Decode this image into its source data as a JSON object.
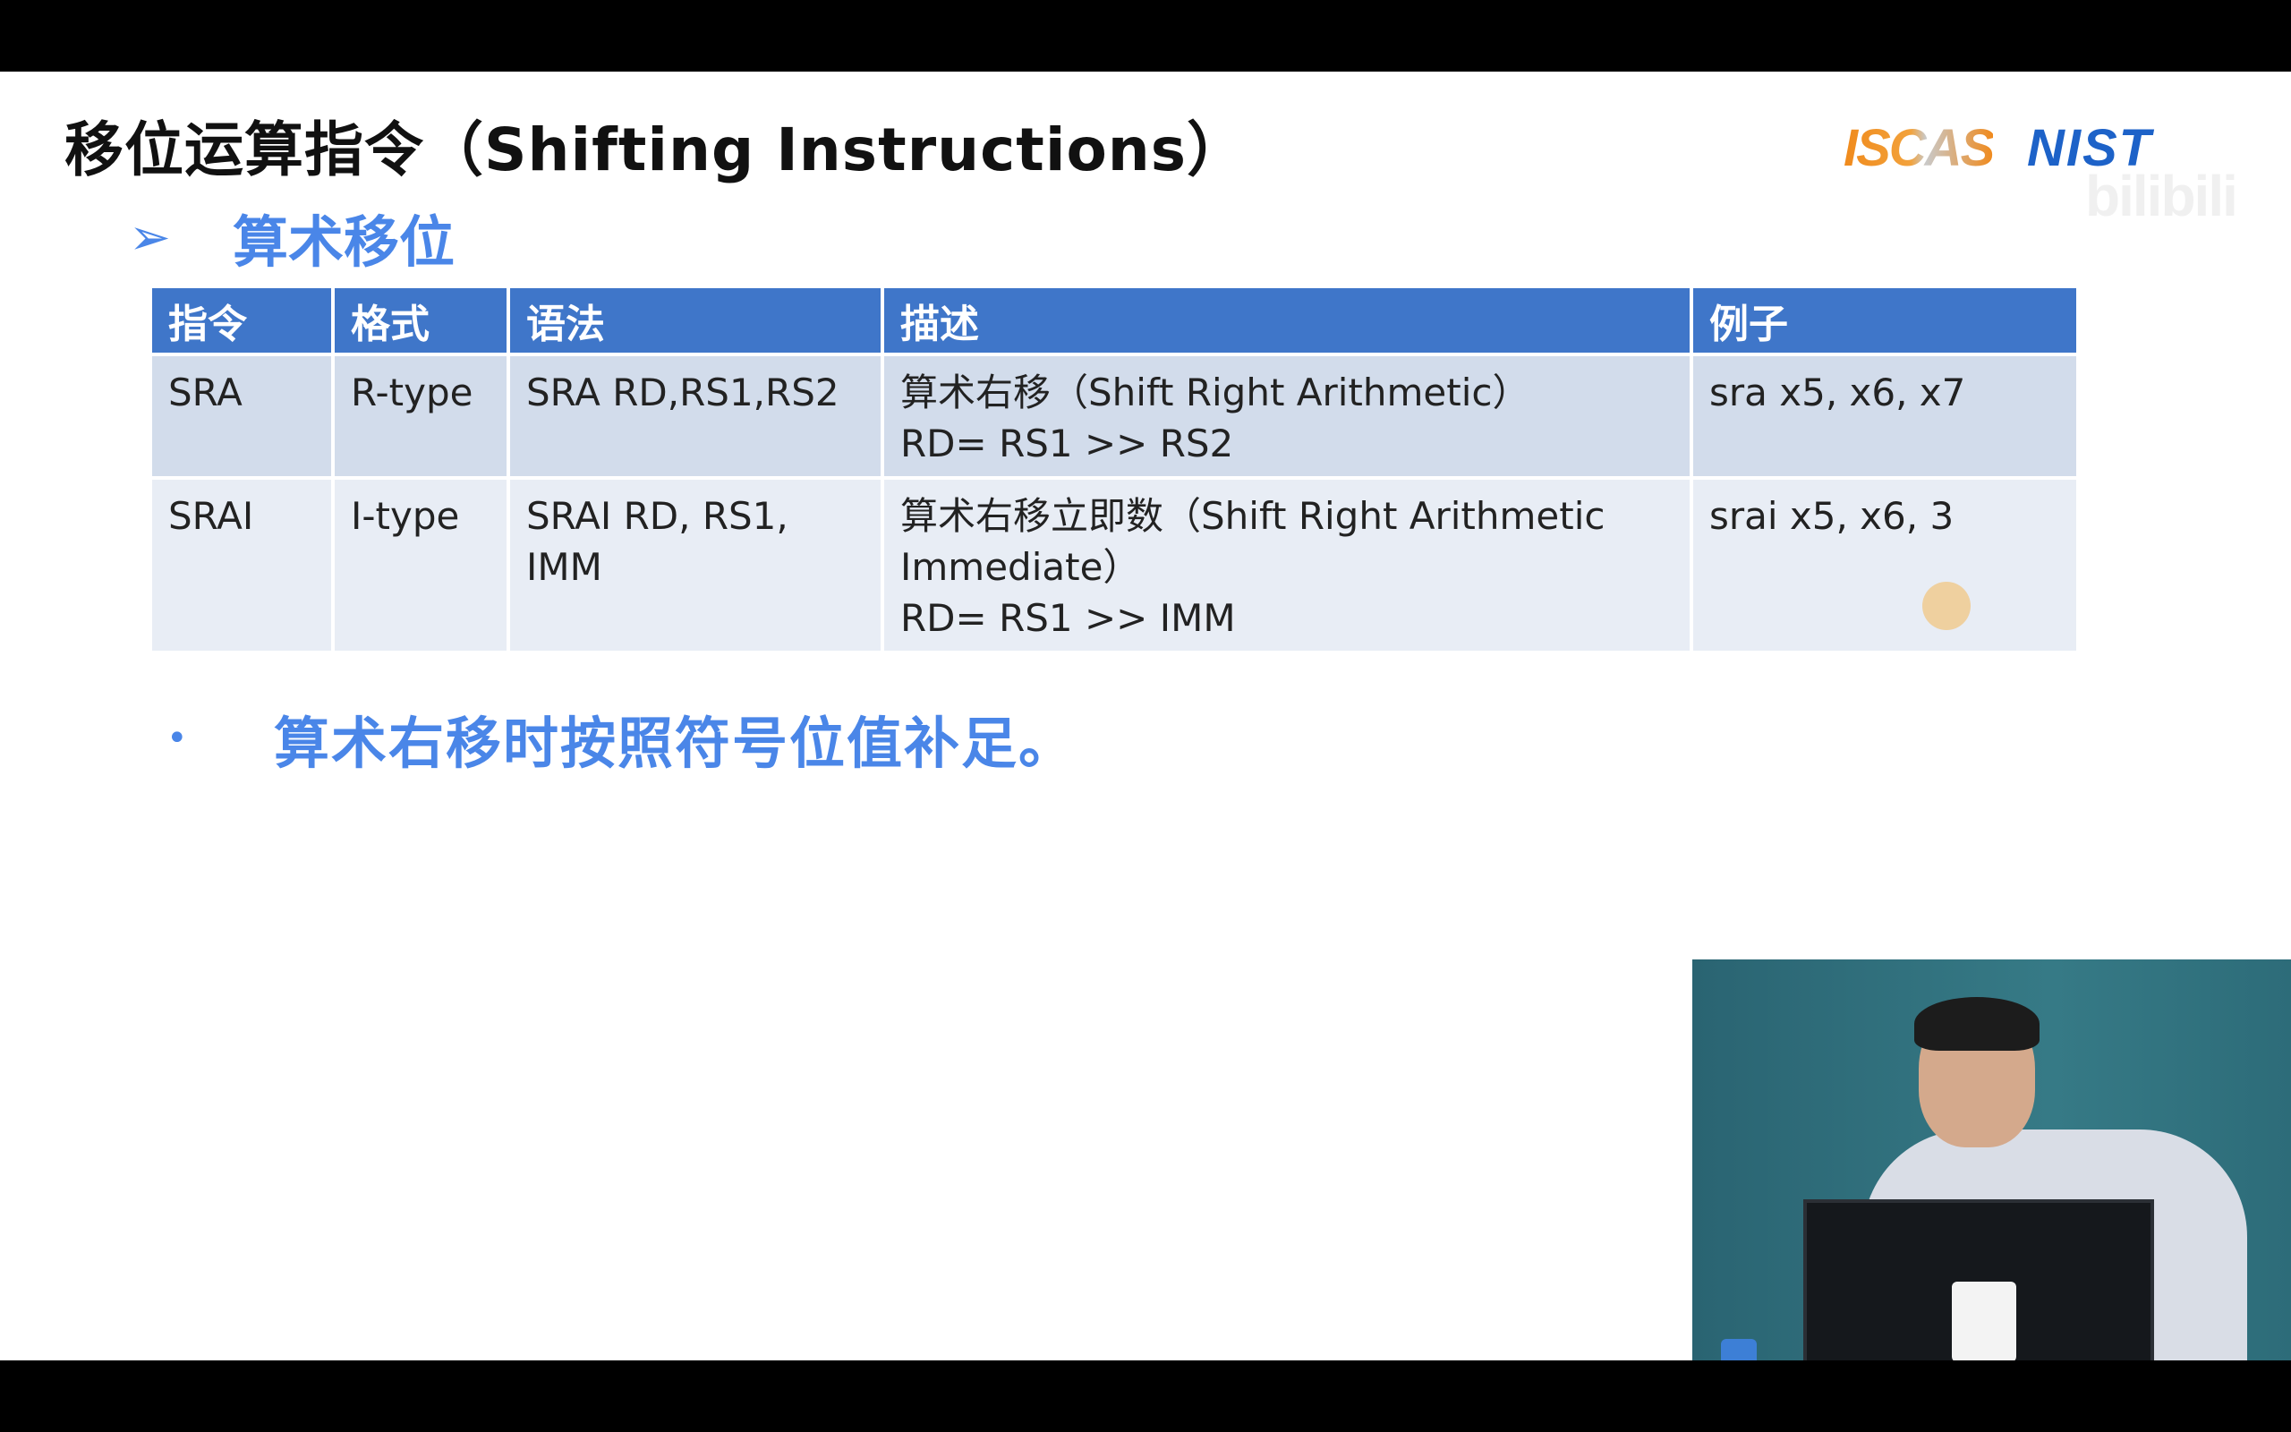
{
  "slide": {
    "title": "移位运算指令（Shifting Instructions）",
    "logos": {
      "iscas": "ISCAS",
      "nist": "NIST"
    },
    "watermark": "bilibili",
    "section": {
      "marker": "➢",
      "title": "算术移位"
    },
    "table": {
      "headers": [
        "指令",
        "格式",
        "语法",
        "描述",
        "例子"
      ],
      "rows": [
        {
          "instr": "SRA",
          "format": "R-type",
          "syntax_1": "SRA RD,RS1,RS2",
          "syntax_2": "",
          "desc_1": "算术右移（Shift Right Arithmetic）",
          "desc_2": "RD= RS1 >> RS2",
          "desc_3": "",
          "example": "sra x5, x6, x7"
        },
        {
          "instr": "SRAI",
          "format": "I-type",
          "syntax_1": "SRAI RD, RS1,",
          "syntax_2": "IMM",
          "desc_1": "算术右移立即数（Shift Right Arithmetic",
          "desc_2": "Immediate）",
          "desc_3": "RD= RS1 >> IMM",
          "example": "srai x5, x6, 3"
        }
      ]
    },
    "bullet": {
      "marker": "•",
      "text": "算术右移时按照符号位值补足。"
    },
    "colors": {
      "accent": "#4a86e8",
      "header_bg": "#3f76c9",
      "row_a": "#d2dceb",
      "row_b": "#e8edf5"
    }
  }
}
